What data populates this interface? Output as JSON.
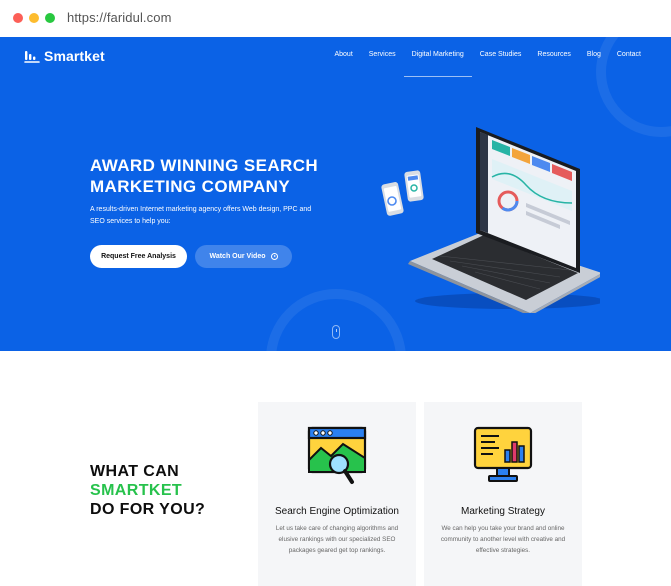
{
  "browser": {
    "url": "https://faridul.com"
  },
  "brand": {
    "name": "Smartket",
    "hero_color": "#0b62e6",
    "accent_green": "#27c24c"
  },
  "nav": {
    "items": [
      {
        "label": "About"
      },
      {
        "label": "Services"
      },
      {
        "label": "Digital Marketing",
        "active": true
      },
      {
        "label": "Case Studies"
      },
      {
        "label": "Resources"
      },
      {
        "label": "Blog"
      },
      {
        "label": "Contact"
      }
    ]
  },
  "hero": {
    "title_line1": "AWARD WINNING SEARCH",
    "title_line2": "MARKETING COMPANY",
    "subtitle": "A results-driven Internet marketing agency offers Web design, PPC and SEO services to help you:",
    "primary_button": "Request Free Analysis",
    "secondary_button": "Watch Our Video"
  },
  "services": {
    "heading_line1": "WHAT CAN",
    "heading_line2": "SMARTKET",
    "heading_line3": "DO FOR YOU?",
    "cards": [
      {
        "title": "Search Engine Optimization",
        "text": "Let us take care of changing algorithms and elusive rankings with our specialized SEO packages geared get top rankings.",
        "icon": "seo-browser-magnifier-icon"
      },
      {
        "title": "Marketing Strategy",
        "text": "We can help you take your brand and online community to another level with creative and effective strategies.",
        "icon": "monitor-chart-icon"
      }
    ]
  }
}
